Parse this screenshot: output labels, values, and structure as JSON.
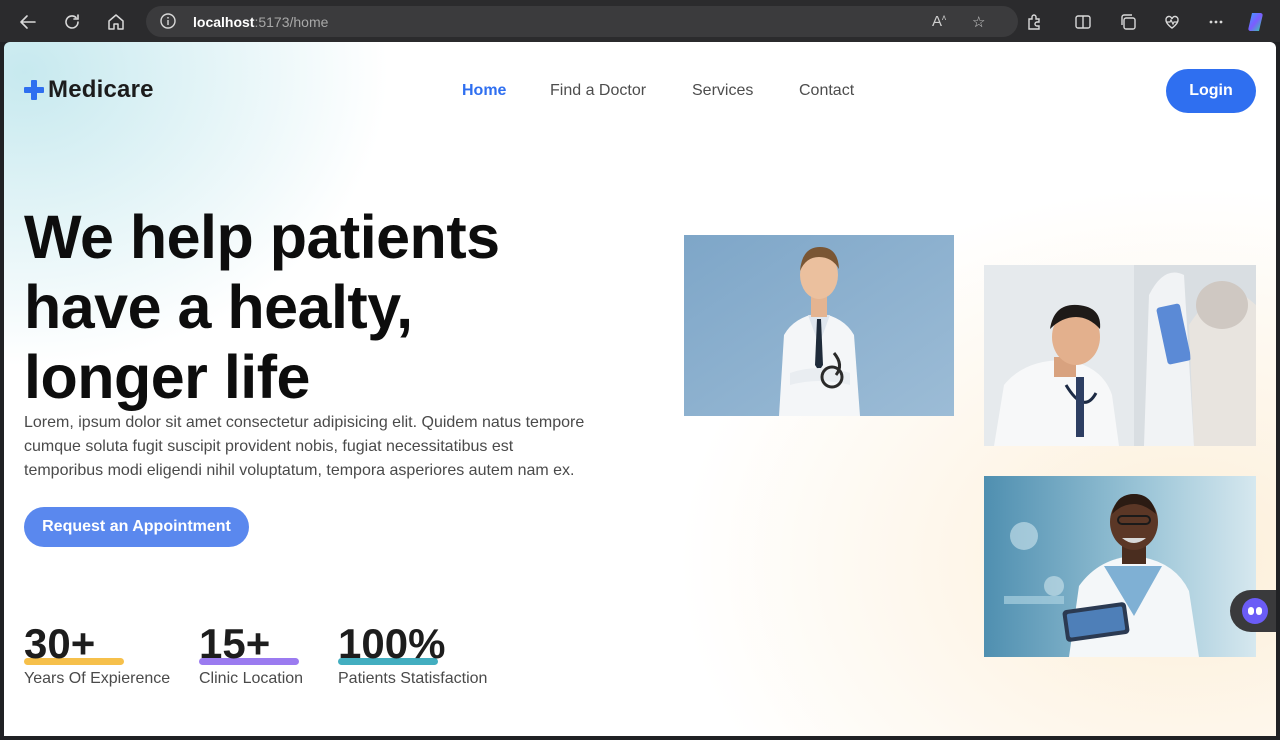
{
  "browser": {
    "url_host": "localhost",
    "url_path": ":5173/home"
  },
  "nav": {
    "brand": "Medicare",
    "links": [
      "Home",
      "Find a Doctor",
      "Services",
      "Contact"
    ],
    "active": "Home",
    "login_label": "Login"
  },
  "hero": {
    "title_line1": "We help patients",
    "title_line2": "have a healty,",
    "title_line3": "longer life",
    "description": "Lorem, ipsum dolor sit amet consectetur adipisicing elit. Quidem natus tempore cumque soluta fugit suscipit provident nobis, fugiat necessitatibus est temporibus modi eligendi nihil voluptatum, tempora asperiores autem nam ex.",
    "cta_label": "Request an Appointment"
  },
  "stats": [
    {
      "value": "30+",
      "label": "Years Of Expierence",
      "color": "#f6c04b"
    },
    {
      "value": "15+",
      "label": "Clinic Location",
      "color": "#9b7bf0"
    },
    {
      "value": "100%",
      "label": "Patients Statisfaction",
      "color": "#43aec0"
    }
  ],
  "colors": {
    "primary": "#2f6ff0",
    "cta": "#5a88ee"
  }
}
